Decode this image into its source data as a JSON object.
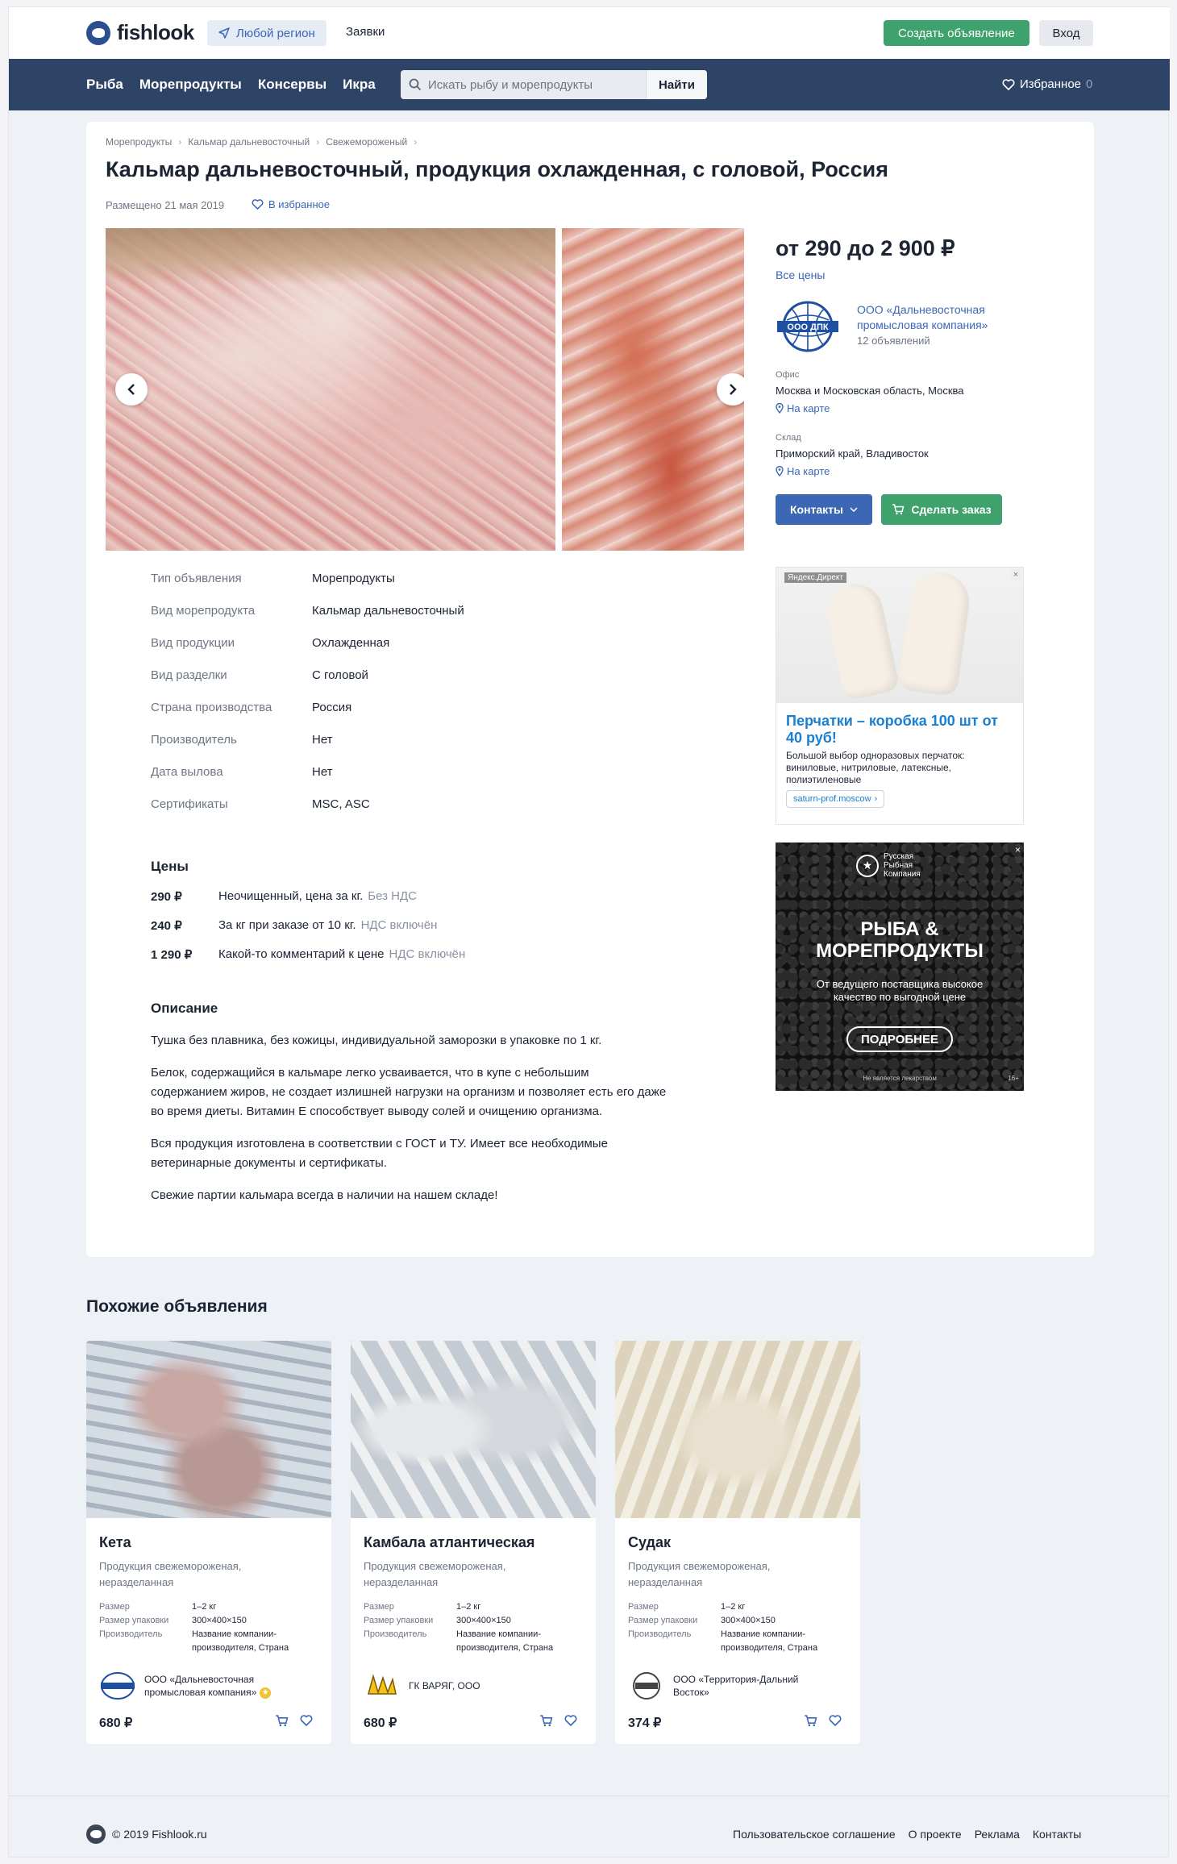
{
  "header": {
    "logo_text": "fishlook",
    "region_label": "Любой регион",
    "orders_label": "Заявки",
    "create_label": "Создать объявление",
    "login_label": "Вход"
  },
  "nav": {
    "items": [
      "Рыба",
      "Морепродукты",
      "Консервы",
      "Икра"
    ],
    "search_placeholder": "Искать рыбу и морепродукты",
    "search_button": "Найти",
    "favorites_label": "Избранное",
    "favorites_count": "0"
  },
  "listing": {
    "breadcrumbs": [
      "Морепродукты",
      "Кальмар дальневосточный",
      "Свежемороженый"
    ],
    "title": "Кальмар дальневосточный, продукция охлажденная, с головой, Россия",
    "posted": "Размещено 21 мая 2019",
    "favorite_label": "В избранное",
    "price_range": "от 290 до 2 900 ₽",
    "all_prices": "Все цены",
    "seller_logo_text": "ООО ДПК",
    "seller_name": "ООО «Дальневосточная промысловая компания»",
    "seller_ads": "12 объявлений",
    "office_label": "Офис",
    "office_value": "Москва и Московская область, Москва",
    "warehouse_label": "Склад",
    "warehouse_value": "Приморский край, Владивосток",
    "map_link": "На карте",
    "contacts_button": "Контакты",
    "order_button": "Сделать заказ",
    "specs": [
      {
        "k": "Тип объявления",
        "v": "Морепродукты"
      },
      {
        "k": "Вид морепродукта",
        "v": "Кальмар дальневосточный"
      },
      {
        "k": "Вид продукции",
        "v": "Охлажденная"
      },
      {
        "k": "Вид разделки",
        "v": "С головой"
      },
      {
        "k": "Страна производства",
        "v": "Россия"
      },
      {
        "k": "Производитель",
        "v": "Нет"
      },
      {
        "k": "Дата вылова",
        "v": "Нет"
      },
      {
        "k": "Сертификаты",
        "v": "MSC, ASC"
      }
    ],
    "prices_heading": "Цены",
    "prices": [
      {
        "value": "290 ₽",
        "comment": "Неочищенный, цена за кг.",
        "tax": "Без НДС"
      },
      {
        "value": "240 ₽",
        "comment": "За кг при заказе от 10 кг.",
        "tax": "НДС включён"
      },
      {
        "value": "1 290 ₽",
        "comment": "Какой-то комментарий к цене",
        "tax": "НДС включён"
      }
    ],
    "description_heading": "Описание",
    "description": [
      "Тушка без плавника, без кожицы, индивидуальной заморозки в упаковке по 1 кг.",
      "Белок, содержащийся в кальмаре легко усваивается, что в купе с небольшим содержанием жиров, не создает излишней нагрузки на организм и позволяет есть его даже во время диеты. Витамин Е способствует выводу солей и очищению организма.",
      "Вся продукция изготовлена в соответствии с ГОСТ и ТУ. Имеет все необходимые ветеринарные документы и сертификаты.",
      "Свежие партии кальмара всегда в наличии на нашем складе!"
    ]
  },
  "ads": {
    "ad1_source": "Яндекс.Директ",
    "ad1_close": "×",
    "ad1_title": "Перчатки – коробка 100 шт от 40 руб!",
    "ad1_text": "Большой выбор одноразовых перчаток: виниловые, нитриловые, латексные, полиэтиленовые",
    "ad1_link": "saturn-prof.moscow",
    "ad2_brand_line1": "Русская",
    "ad2_brand_line2": "Рыбная",
    "ad2_brand_line3": "Компания",
    "ad2_title_line1": "РЫБА &",
    "ad2_title_line2": "МОРЕПРОДУКТЫ",
    "ad2_sub": "От ведущего поставщика высокое качество по выгодной цене",
    "ad2_button": "ПОДРОБНЕЕ",
    "ad2_foot": "Не является лекарством",
    "ad2_age": "16+",
    "ad2_close": "×"
  },
  "similar": {
    "heading": "Похожие объявления",
    "labels": {
      "size": "Размер",
      "pack": "Размер упаковки",
      "maker": "Производитель"
    },
    "items": [
      {
        "name": "Кета",
        "desc": "Продукция свежемороженая, неразделанная",
        "size": "1–2 кг",
        "pack": "300×400×150",
        "maker": "Название компании-производителя, Страна",
        "seller": "ООО «Дальневосточная промысловая компания»",
        "price": "680 ₽"
      },
      {
        "name": "Камбала атлантическая",
        "desc": "Продукция свежемороженая, неразделанная",
        "size": "1–2 кг",
        "pack": "300×400×150",
        "maker": "Название компании-производителя, Страна",
        "seller": "ГК ВАРЯГ, ООО",
        "price": "680 ₽"
      },
      {
        "name": "Судак",
        "desc": "Продукция свежемороженая, неразделанная",
        "size": "1–2 кг",
        "pack": "300×400×150",
        "maker": "Название компании-производителя, Страна",
        "seller": "ООО «Территория-Дальний Восток»",
        "price": "374 ₽"
      }
    ]
  },
  "footer": {
    "copyright": "© 2019 Fishlook.ru",
    "links": [
      "Пользовательское соглашение",
      "О проекте",
      "Реклама",
      "Контакты"
    ]
  },
  "colors": {
    "nav_bg": "#2e4466",
    "accent_blue": "#3b67b5",
    "accent_green": "#3fa16c",
    "page_bg": "#eef1f6"
  },
  "icons": [
    "fish-logo-icon",
    "navigation-arrow-icon",
    "search-icon",
    "heart-icon",
    "chevron-left-icon",
    "chevron-right-icon",
    "map-pin-icon",
    "chevron-down-icon",
    "cart-icon",
    "star-badge-icon"
  ]
}
